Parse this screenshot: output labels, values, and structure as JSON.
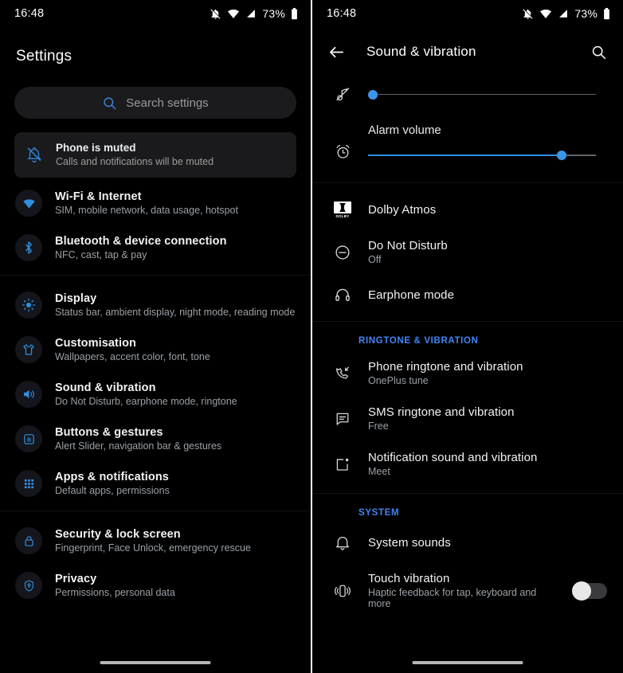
{
  "status_bar": {
    "time": "16:48",
    "battery_percent": "73%"
  },
  "left": {
    "title": "Settings",
    "search": {
      "placeholder": "Search settings"
    },
    "muted_card": {
      "title": "Phone is muted",
      "subtitle": "Calls and notifications will be muted"
    },
    "groups": [
      {
        "items": [
          {
            "icon": "wifi-icon",
            "title": "Wi-Fi & Internet",
            "subtitle": "SIM, mobile network, data usage, hotspot"
          },
          {
            "icon": "bluetooth-icon",
            "title": "Bluetooth & device connection",
            "subtitle": "NFC, cast, tap & pay"
          }
        ]
      },
      {
        "items": [
          {
            "icon": "brightness-icon",
            "title": "Display",
            "subtitle": "Status bar, ambient display, night mode, reading mode"
          },
          {
            "icon": "tshirt-icon",
            "title": "Customisation",
            "subtitle": "Wallpapers, accent color, font, tone"
          },
          {
            "icon": "speaker-icon",
            "title": "Sound & vibration",
            "subtitle": "Do Not Disturb, earphone mode, ringtone"
          },
          {
            "icon": "button-b-icon",
            "title": "Buttons & gestures",
            "subtitle": "Alert Slider, navigation bar & gestures"
          },
          {
            "icon": "apps-grid-icon",
            "title": "Apps & notifications",
            "subtitle": "Default apps, permissions"
          }
        ]
      },
      {
        "items": [
          {
            "icon": "lock-icon",
            "title": "Security & lock screen",
            "subtitle": "Fingerprint, Face Unlock, emergency rescue"
          },
          {
            "icon": "privacy-shield-icon",
            "title": "Privacy",
            "subtitle": "Permissions, personal data"
          }
        ]
      }
    ]
  },
  "right": {
    "appbar": {
      "title": "Sound & vibration"
    },
    "sliders": [
      {
        "icon": "media-muted-icon",
        "label": "",
        "value": 2
      },
      {
        "icon": "alarm-clock-icon",
        "label": "Alarm volume",
        "value": 85
      }
    ],
    "sections": [
      {
        "header": "",
        "items": [
          {
            "icon": "dolby-icon",
            "title": "Dolby Atmos",
            "subtitle": ""
          },
          {
            "icon": "do-not-disturb-icon",
            "title": "Do Not Disturb",
            "subtitle": "Off"
          },
          {
            "icon": "headphones-icon",
            "title": "Earphone mode",
            "subtitle": ""
          }
        ]
      },
      {
        "header": "RINGTONE & VIBRATION",
        "items": [
          {
            "icon": "phone-ringtone-icon",
            "title": "Phone ringtone and vibration",
            "subtitle": "OnePlus tune"
          },
          {
            "icon": "sms-icon",
            "title": "SMS ringtone and vibration",
            "subtitle": "Free"
          },
          {
            "icon": "notification-square-icon",
            "title": "Notification sound and vibration",
            "subtitle": "Meet"
          }
        ]
      },
      {
        "header": "SYSTEM",
        "items": [
          {
            "icon": "bell-icon",
            "title": "System sounds",
            "subtitle": ""
          },
          {
            "icon": "vibration-icon",
            "title": "Touch vibration",
            "subtitle": "Haptic feedback for tap, keyboard and more",
            "toggle": "off"
          }
        ]
      }
    ]
  },
  "colors": {
    "accent_blue": "#4285f4",
    "slider_blue": "#3b96e8",
    "icon_blue": "#2f7fd1"
  }
}
